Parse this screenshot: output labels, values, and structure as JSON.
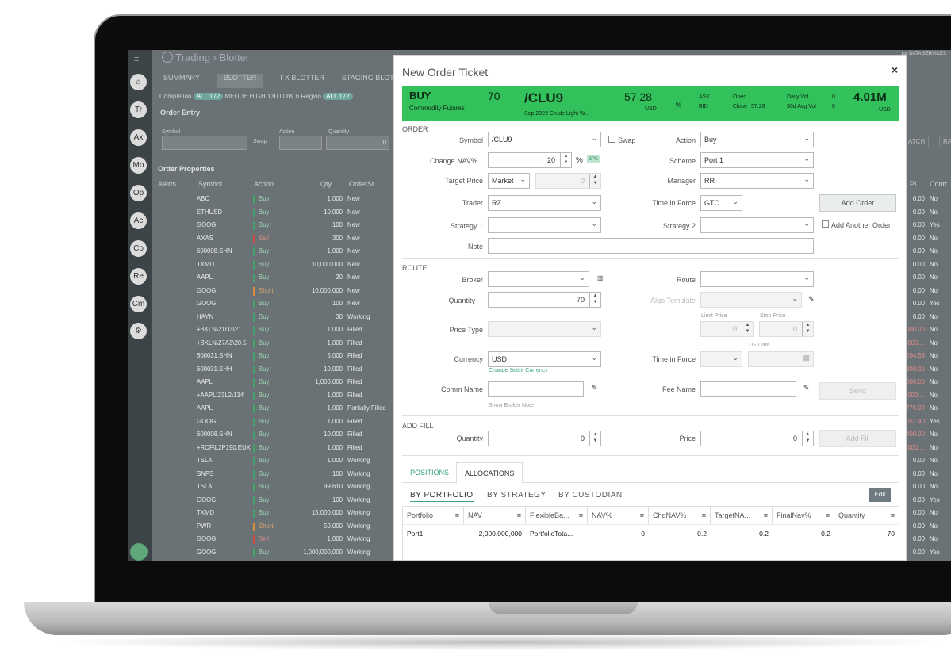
{
  "app": {
    "brand": "Trading",
    "page": "Blotter",
    "tabs": [
      "SUMMARY",
      "BLOTTER",
      "FX BLOTTER",
      "STAGING BLOTTER"
    ],
    "filters": {
      "completion_label": "Completion",
      "all": "ALL",
      "all_count": "172",
      "med": "MED",
      "med_count": "36",
      "high": "HIGH",
      "high_count": "130",
      "low": "LOW",
      "low_count": "6",
      "region_label": "Region",
      "region_all": "ALL",
      "region_count": "172"
    },
    "order_entry": {
      "title": "Order Entry",
      "symbol": "Symbol",
      "action": "Action",
      "quantity": "Quantity",
      "swap": "Swap",
      "qty_value": "0"
    },
    "order_properties": "Order Properties",
    "columns": [
      "Alerts",
      "Symbol",
      "Action",
      "Qty",
      "OrderSt..."
    ],
    "right_columns": [
      "PL",
      "Contr"
    ],
    "right_buttons": [
      "ATCH",
      "RAC"
    ],
    "rows": [
      {
        "symbol": "ABC",
        "action": "Buy",
        "qty": "1,000",
        "status": "New",
        "pl": "0.00",
        "c": "No"
      },
      {
        "symbol": "ETHUSD",
        "action": "Buy",
        "qty": "10,000",
        "status": "New",
        "pl": "0.00",
        "c": "No"
      },
      {
        "symbol": "GOOG",
        "action": "Buy",
        "qty": "100",
        "status": "New",
        "pl": "0.00",
        "c": "Yes"
      },
      {
        "symbol": "AXAS",
        "action": "Sell",
        "qty": "300",
        "status": "New",
        "pl": "0.00",
        "c": "No"
      },
      {
        "symbol": "600008.SHN",
        "action": "Buy",
        "qty": "1,000",
        "status": "New",
        "pl": "0.00",
        "c": "No"
      },
      {
        "symbol": "TXMD",
        "action": "Buy",
        "qty": "10,000,000",
        "status": "New",
        "pl": "0.00",
        "c": "No"
      },
      {
        "symbol": "AAPL",
        "action": "Buy",
        "qty": "20",
        "status": "New",
        "pl": "0.00",
        "c": "No"
      },
      {
        "symbol": "GOOG",
        "action": "Short",
        "qty": "10,000,000",
        "status": "New",
        "pl": "0.00",
        "c": "No"
      },
      {
        "symbol": "GOOG",
        "action": "Buy",
        "qty": "100",
        "status": "New",
        "pl": "0.00",
        "c": "Yes"
      },
      {
        "symbol": "HAYN",
        "action": "Buy",
        "qty": "30",
        "status": "Working",
        "pl": "0.00",
        "c": "No"
      },
      {
        "symbol": "+BKLN\\21D3\\21",
        "action": "Buy",
        "qty": "1,000",
        "status": "Filled",
        "pl": "000.00",
        "c": "No"
      },
      {
        "symbol": "+BKLN\\27A3\\20.5",
        "action": "Buy",
        "qty": "1,000",
        "status": "Filled",
        "pl": "(000....",
        "c": "No"
      },
      {
        "symbol": "600031.SHN",
        "action": "Buy",
        "qty": "5,000",
        "status": "Filled",
        "pl": "204.58",
        "c": "No"
      },
      {
        "symbol": "600031.SHH",
        "action": "Buy",
        "qty": "10,000",
        "status": "Filled",
        "pl": "300.00",
        "c": "No"
      },
      {
        "symbol": "AAPL",
        "action": "Buy",
        "qty": "1,000,000",
        "status": "Filled",
        "pl": "000.00",
        "c": "No"
      },
      {
        "symbol": "+AAPL\\23L2\\134",
        "action": "Buy",
        "qty": "1,000",
        "status": "Filled",
        "pl": "(000....",
        "c": "No"
      },
      {
        "symbol": "AAPL",
        "action": "Buy",
        "qty": "1,000",
        "status": "Partially Filled",
        "pl": "776.00",
        "c": "No"
      },
      {
        "symbol": "GOOG",
        "action": "Buy",
        "qty": "1,000",
        "status": "Filled",
        "pl": "051.40",
        "c": "Yes"
      },
      {
        "symbol": "600008.SHN",
        "action": "Buy",
        "qty": "10,000",
        "status": "Filled",
        "pl": "400.00",
        "c": "No"
      },
      {
        "symbol": "+RCF\\L2P190.EUX",
        "action": "Buy",
        "qty": "1,000",
        "status": "Filled",
        "pl": "(000....",
        "c": "No"
      },
      {
        "symbol": "TSLA",
        "action": "Buy",
        "qty": "1,000",
        "status": "Working",
        "pl": "0.00",
        "c": "No"
      },
      {
        "symbol": "SNPS",
        "action": "Buy",
        "qty": "100",
        "status": "Working",
        "pl": "0.00",
        "c": "No"
      },
      {
        "symbol": "TSLA",
        "action": "Buy",
        "qty": "99,610",
        "status": "Working",
        "pl": "0.00",
        "c": "No"
      },
      {
        "symbol": "GOOG",
        "action": "Buy",
        "qty": "100",
        "status": "Working",
        "pl": "0.00",
        "c": "Yes"
      },
      {
        "symbol": "TXMD",
        "action": "Buy",
        "qty": "15,000,000",
        "status": "Working",
        "pl": "0.00",
        "c": "No"
      },
      {
        "symbol": "PWR",
        "action": "Short",
        "qty": "50,000",
        "status": "Working",
        "pl": "0.00",
        "c": "No"
      },
      {
        "symbol": "GOOG",
        "action": "Sell",
        "qty": "1,000",
        "status": "Working",
        "pl": "0.00",
        "c": "No"
      },
      {
        "symbol": "GOOG",
        "action": "Buy",
        "qty": "1,000,000,000",
        "status": "Working",
        "pl": "0.00",
        "c": "Yes"
      }
    ],
    "sidebar": [
      "Tr",
      "Ax",
      "Mo",
      "Op",
      "Ac",
      "Co",
      "Re",
      "Cm"
    ],
    "corner_logo": "ice DATA SERVICES"
  },
  "modal": {
    "title": "New Order Ticket",
    "close": "×",
    "banner": {
      "side": "BUY",
      "asset_class": "Commodity Futures",
      "qty": "70",
      "symbol": "/CLU9",
      "description": "Sep 2029 Crude Light W...",
      "price": "57.28",
      "ccy": "USD",
      "pct": "%",
      "ask": "ASK",
      "bid": "BID",
      "open": "Open",
      "close": "Close",
      "close_val": "57.28",
      "daily_vol": "Daily Vol",
      "daily_val": "0",
      "avg_vol": "30d Avg Vol",
      "avg_val": "0",
      "notional": "4.01M",
      "notional_ccy": "USD"
    },
    "order": {
      "section": "ORDER",
      "symbol_label": "Symbol",
      "symbol": "/CLU9",
      "swap": "Swap",
      "action_label": "Action",
      "action": "Buy",
      "nav_label": "Change NAV%",
      "nav": "20",
      "pct": "%",
      "bps": "BPS",
      "scheme_label": "Scheme",
      "scheme": "Port 1",
      "target_label": "Target Price",
      "target_type": "Market",
      "target_val": "0",
      "manager_label": "Manager",
      "manager": "RR",
      "trader_label": "Trader",
      "trader": "RZ",
      "tif_label": "Time in Force",
      "tif": "GTC",
      "add_order": "Add Order",
      "strategy1": "Strategy 1",
      "strategy2": "Strategy 2",
      "add_another": "Add Another Order",
      "note": "Note"
    },
    "route": {
      "section": "ROUTE",
      "broker": "Broker",
      "route": "Route",
      "quantity": "Quantity",
      "qty": "70",
      "algo": "Algo Template",
      "limit": "Limit Price",
      "stop": "Stop Price",
      "limit_val": "0",
      "stop_val": "0",
      "price_type": "Price Type",
      "tif_date": "TIF Date",
      "currency_label": "Currency",
      "currency": "USD",
      "change_settle": "Change Settle Currency",
      "tif_label": "Time in Force",
      "comm": "Comm Name",
      "fee": "Fee Name",
      "send": "Send",
      "show_note": "Show Broker Note"
    },
    "fill": {
      "section": "ADD FILL",
      "quantity": "Quantity",
      "qty": "0",
      "price": "Price",
      "price_val": "0",
      "add_fill": "Add Fill"
    },
    "tabs": {
      "positions": "POSITIONS",
      "allocations": "ALLOCATIONS",
      "by_portfolio": "BY PORTFOLIO",
      "by_strategy": "BY STRATEGY",
      "by_custodian": "BY CUSTODIAN",
      "edit": "Edit"
    },
    "table": {
      "headers": [
        "Portfolio",
        "NAV",
        "FlexibleBa...",
        "NAV%",
        "ChgNAV%",
        "TargetNA...",
        "FinalNav%",
        "Quantity"
      ],
      "row": [
        "Port1",
        "2,000,000,000",
        "PortfolioTota...",
        "0",
        "0.2",
        "0.2",
        "0.2",
        "70"
      ]
    }
  }
}
